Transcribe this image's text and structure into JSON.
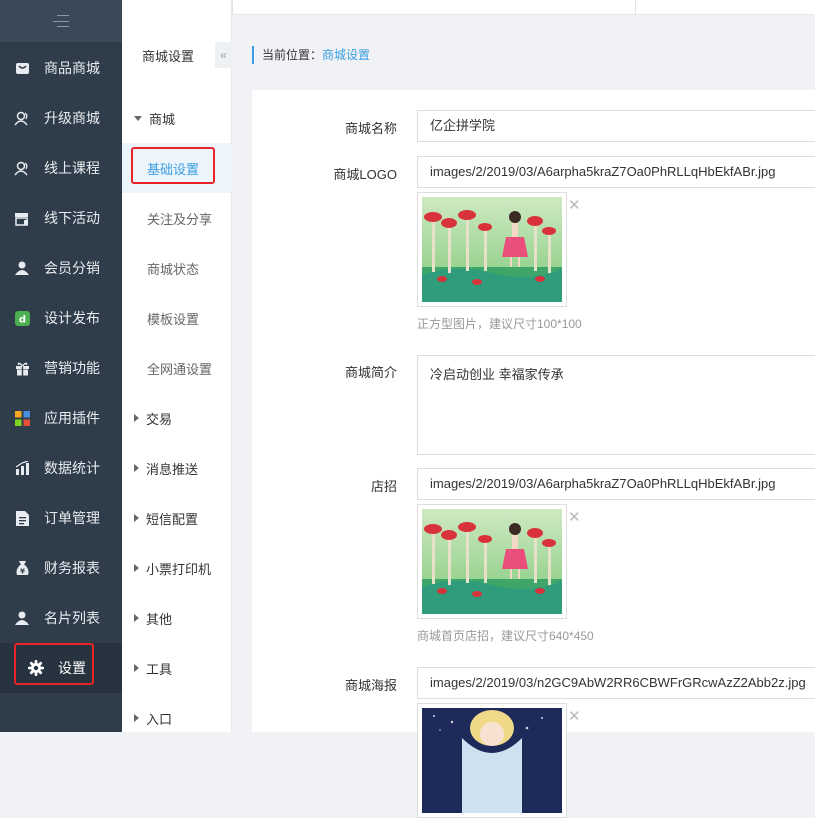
{
  "sidebar": {
    "items": [
      {
        "label": "商品商城",
        "icon": "shop-bag-icon"
      },
      {
        "label": "升级商城",
        "icon": "users-icon"
      },
      {
        "label": "线上课程",
        "icon": "users-icon"
      },
      {
        "label": "线下活动",
        "icon": "store-icon"
      },
      {
        "label": "会员分销",
        "icon": "user-icon"
      },
      {
        "label": "设计发布",
        "icon": "design-icon"
      },
      {
        "label": "营销功能",
        "icon": "gift-icon"
      },
      {
        "label": "应用插件",
        "icon": "apps-icon"
      },
      {
        "label": "数据统计",
        "icon": "bar-chart-icon"
      },
      {
        "label": "订单管理",
        "icon": "document-icon"
      },
      {
        "label": "财务报表",
        "icon": "money-bag-icon"
      },
      {
        "label": "名片列表",
        "icon": "user-icon"
      },
      {
        "label": "设置",
        "icon": "gear-icon"
      }
    ]
  },
  "subnav": {
    "title": "商城设置",
    "groups": [
      {
        "label": "商城",
        "expanded": true
      },
      {
        "label": "交易"
      },
      {
        "label": "消息推送"
      },
      {
        "label": "短信配置"
      },
      {
        "label": "小票打印机"
      },
      {
        "label": "其他"
      },
      {
        "label": "工具"
      },
      {
        "label": "入口"
      }
    ],
    "items": [
      "基础设置",
      "关注及分享",
      "商城状态",
      "模板设置",
      "全网通设置"
    ]
  },
  "breadcrumb": {
    "prefix": "当前位置：",
    "current": "商城设置"
  },
  "form": {
    "name_label": "商城名称",
    "name_value": "亿企拼学院",
    "logo_label": "商城LOGO",
    "logo_value": "images/2/2019/03/A6arpha5kraZ7Oa0PhRLLqHbEkfABr.jpg",
    "logo_hint": "正方型图片，建议尺寸100*100",
    "intro_label": "商城简介",
    "intro_value": "冷启动创业 幸福家传承",
    "sign_label": "店招",
    "sign_value": "images/2/2019/03/A6arpha5kraZ7Oa0PhRLLqHbEkfABr.jpg",
    "sign_hint": "商城首页店招，建议尺寸640*450",
    "poster_label": "商城海报",
    "poster_value": "images/2/2019/03/n2GC9AbW2RR6CBWFrGRcwAzZ2Abb2z.jpg",
    "remove_symbol": "✕"
  },
  "colors": {
    "sidebar_bg": "#2f3d4a",
    "accent": "#3b9ee0",
    "highlight": "#e8242a"
  }
}
